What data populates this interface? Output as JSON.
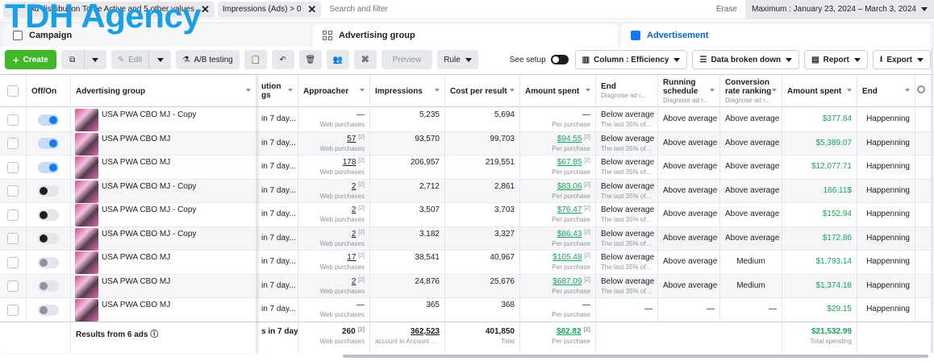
{
  "watermark": "TDH Agency",
  "filters": {
    "chip1": "Ad distribution To be Active and 5 other values",
    "chip2": "Impressions (Ads) > 0",
    "search_placeholder": "Search and filter",
    "erase": "Erase",
    "date_range": "Maximum : January 23, 2024 – March 3, 2024"
  },
  "levels": {
    "campaign": "Campaign",
    "group": "Advertising group",
    "ad": "Advertisement"
  },
  "toolbar": {
    "create": "Create",
    "edit": "Edit",
    "ab_testing": "A/B testing",
    "preview": "Preview",
    "rule": "Rule",
    "see_setup": "See setup",
    "column": "Column : Efficiency",
    "breakdown": "Data broken down",
    "report": "Report",
    "export": "Export"
  },
  "headers": {
    "onoff": "Off/On",
    "group": "Advertising group",
    "attribution_1": "ution",
    "attribution_2": "gs",
    "approacher": "Approacher",
    "impressions": "Impressions",
    "cost": "Cost per result",
    "amount": "Amount spent",
    "end": "End",
    "end_sub": "Diagnose ad r...",
    "running_1": "Running",
    "running_2": "schedule",
    "running_sub": "Diagnose ad r...",
    "conv_1": "Conversion",
    "conv_2": "rate ranking",
    "conv_sub": "Diagnose ad r...",
    "amount2": "Amount spent",
    "end2": "End"
  },
  "rows": [
    {
      "toggle": "on",
      "name": "USA PWA CBO MJ - Copy",
      "attr": "in 7 day...",
      "appr": "—",
      "appr_sup": "",
      "appr_sub": "Web purchases",
      "impr": "5,235",
      "cost": "5,694",
      "amt": "—",
      "amt_sup": "",
      "amt_sub": "Per purchase",
      "end": "Below average",
      "end_sub": "The last 35% of t...",
      "sched": "Above average",
      "conv": "Above average",
      "amt2": "$377.84",
      "end2": "Happenning"
    },
    {
      "toggle": "on",
      "name": "USA PWA CBO MJ",
      "attr": "in 7 day...",
      "appr": "57",
      "appr_sup": "[2]",
      "appr_sub": "Web purchases",
      "impr": "93,570",
      "cost": "99,703",
      "amt": "$94.55",
      "amt_sup": "[2]",
      "amt_sub": "Per purchase",
      "end": "Below average",
      "end_sub": "The last 35% of t...",
      "sched": "Above average",
      "conv": "Above average",
      "amt2": "$5,389.07",
      "end2": "Happenning"
    },
    {
      "toggle": "on",
      "name": "USA PWA CBO MJ",
      "attr": "in 7 day...",
      "appr": "178",
      "appr_sup": "[2]",
      "appr_sub": "Web purchases",
      "impr": "206,957",
      "cost": "219,551",
      "amt": "$67.85",
      "amt_sup": "[2]",
      "amt_sub": "Per purchase",
      "end": "Below average",
      "end_sub": "The last 35% of t...",
      "sched": "Above average",
      "conv": "Above average",
      "amt2": "$12,077.71",
      "end2": "Happenning"
    },
    {
      "toggle": "off",
      "name": "USA PWA CBO MJ - Copy",
      "attr": "in 7 day...",
      "appr": "2",
      "appr_sup": "[2]",
      "appr_sub": "Web purchases",
      "impr": "2,712",
      "cost": "2,861",
      "amt": "$83.06",
      "amt_sup": "[2]",
      "amt_sub": "Per purchase",
      "end": "Below average",
      "end_sub": "The last 35% of t...",
      "sched": "Above average",
      "conv": "Above average",
      "amt2": "166.11$",
      "end2": "Happenning"
    },
    {
      "toggle": "off",
      "name": "USA PWA CBO MJ - Copy",
      "attr": "in 7 day...",
      "appr": "2",
      "appr_sup": "[2]",
      "appr_sub": "Web purchases",
      "impr": "3,507",
      "cost": "3,703",
      "amt": "$76.47",
      "amt_sup": "[2]",
      "amt_sub": "Per purchase",
      "end": "Below average",
      "end_sub": "The last 35% of t...",
      "sched": "Above average",
      "conv": "Above average",
      "amt2": "$152.94",
      "end2": "Happenning"
    },
    {
      "toggle": "off",
      "name": "USA PWA CBO MJ - Copy",
      "attr": "in 7 day...",
      "appr": "2",
      "appr_sup": "[2]",
      "appr_sub": "Web purchases",
      "impr": "3.182",
      "cost": "3,327",
      "amt": "$86.43",
      "amt_sup": "[2]",
      "amt_sub": "Per purchase",
      "end": "Below average",
      "end_sub": "The last 35% of t...",
      "sched": "Above average",
      "conv": "Above average",
      "amt2": "$172.86",
      "end2": "Happenning"
    },
    {
      "toggle": "dim",
      "name": "USA PWA CBO MJ",
      "attr": "in 7 day...",
      "appr": "17",
      "appr_sup": "[2]",
      "appr_sub": "Web purchases",
      "impr": "38,541",
      "cost": "40,967",
      "amt": "$105.48",
      "amt_sup": "[2]",
      "amt_sub": "Per purchase",
      "end": "Below average",
      "end_sub": "The last 35% of t...",
      "sched": "Above average",
      "conv": "Medium",
      "amt2": "$1,793.14",
      "end2": "Happenning"
    },
    {
      "toggle": "dim",
      "name": "USA PWA CBO MJ",
      "attr": "in 7 day...",
      "appr": "2",
      "appr_sup": "[2]",
      "appr_sub": "Web purchases",
      "impr": "24,876",
      "cost": "25,676",
      "amt": "$687.09",
      "amt_sup": "[2]",
      "amt_sub": "Per purchase",
      "end": "Below average",
      "end_sub": "The last 35% of t...",
      "sched": "Above average",
      "conv": "Medium",
      "amt2": "$1,374.18",
      "end2": "Happenning"
    },
    {
      "toggle": "dim",
      "name": "USA PWA CBO MJ",
      "attr": "in 7 day...",
      "appr": "—",
      "appr_sup": "",
      "appr_sub": "Web purchases",
      "impr": "365",
      "cost": "368",
      "amt": "—",
      "amt_sup": "",
      "amt_sub": "Per purchase",
      "end": "—",
      "end_sub": "",
      "sched": "—",
      "conv": "—",
      "amt2": "$29.15",
      "end2": "Happenning"
    }
  ],
  "totals": {
    "label": "Results from 6 ads",
    "attr": "s in 7 day...",
    "appr": "260",
    "appr_sup": "[2]",
    "appr_sub": "Web purchases",
    "impr": "362,523",
    "impr_sub": "account in Account Ce...",
    "cost": "401,850",
    "cost_sub": "Total",
    "amt": "$82.82",
    "amt_sup": "[2]",
    "amt_sub": "Per purchase",
    "amt2": "$21,532.99",
    "amt2_sub": "Total spending"
  }
}
